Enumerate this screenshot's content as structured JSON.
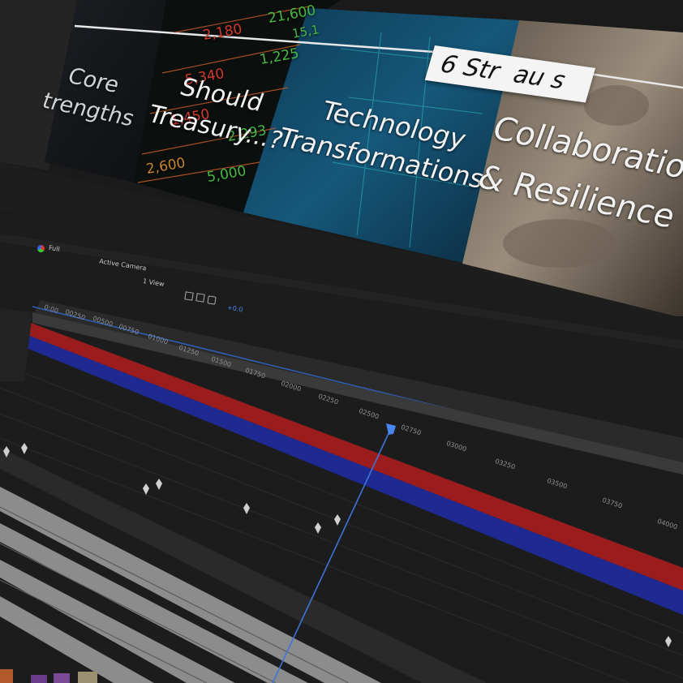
{
  "composition": {
    "title_banner": "6 Str  au s",
    "panels": [
      {
        "id": "core",
        "label_lines": [
          "Core",
          "trengths"
        ]
      },
      {
        "id": "treasury",
        "label_lines": [
          "Should",
          "Treasury...?"
        ],
        "ticker_numbers": [
          "21,600",
          "2,180",
          "5,340",
          "1,225",
          "1,450",
          "2,293",
          "2,600",
          "5,000",
          "15,1"
        ]
      },
      {
        "id": "technology",
        "label_lines": [
          "Technology",
          "Transformations"
        ]
      },
      {
        "id": "collaboration",
        "label_lines": [
          "Collaboration",
          "& Resilience"
        ]
      }
    ]
  },
  "viewer_toolbar": {
    "zoom": "Full",
    "camera": "Active Camera",
    "views": "1 View",
    "exposure": "+0.0"
  },
  "timeline": {
    "ticks": [
      "0:00",
      "00250",
      "00500",
      "00750",
      "01000",
      "01250",
      "01500",
      "01750",
      "02000",
      "02250",
      "02500",
      "02750",
      "03000",
      "03250",
      "03500",
      "03750",
      "04000"
    ],
    "playhead_fraction": 0.65,
    "layers": [
      {
        "name": "layer-red",
        "color": "#9a1c1c"
      },
      {
        "name": "layer-blue",
        "color": "#1e2a92"
      }
    ]
  }
}
